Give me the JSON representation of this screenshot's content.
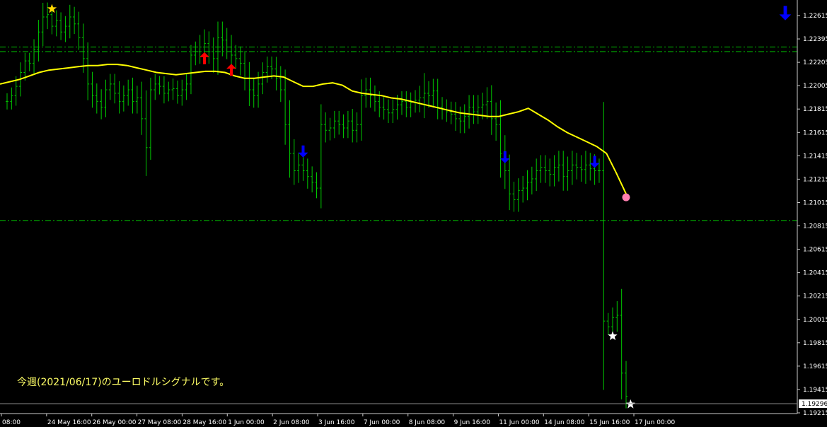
{
  "caption": "今週(2021/06/17)のユーロドルシグナルです。",
  "colors": {
    "background": "#000000",
    "bars": "#00c800",
    "ma_line": "#ffff00",
    "levels": "#00c800",
    "axis": "#cccccc",
    "up_arrow": "#ff0000",
    "down_arrow": "#0000ff",
    "gold_star": "#ffd700",
    "white_star": "#ffffff",
    "pink_dot": "#ff7fb0",
    "current_price_box": "#ffffff"
  },
  "chart_data": {
    "type": "ohlc-line",
    "instrument": "EURUSD",
    "ylim": [
      1.1915,
      1.2269
    ],
    "y_ticks": [
      "1.22615",
      "1.22395",
      "1.22205",
      "1.22005",
      "1.21815",
      "1.21615",
      "1.21415",
      "1.21215",
      "1.21015",
      "1.20815",
      "1.20615",
      "1.20415",
      "1.20215",
      "1.20015",
      "1.19815",
      "1.19615",
      "1.19415",
      "1.19215"
    ],
    "current_price": "1.19296",
    "x_ticks": [
      "08:00",
      "24 May 16:00",
      "26 May 00:00",
      "27 May 08:00",
      "28 May 16:00",
      "1 Jun 00:00",
      "2 Jun 08:00",
      "3 Jun 16:00",
      "7 Jun 00:00",
      "8 Jun 08:00",
      "9 Jun 16:00",
      "11 Jun 00:00",
      "14 Jun 08:00",
      "15 Jun 16:00",
      "17 Jun 00:00"
    ],
    "horizontal_levels": [
      1.2232,
      1.2228,
      1.2082
    ],
    "bars_close": [
      1.2185,
      1.219,
      1.2198,
      1.221,
      1.222,
      1.2218,
      1.223,
      1.2245,
      1.2258,
      1.226,
      1.225,
      1.2255,
      1.2245,
      1.225,
      1.2258,
      1.2252,
      1.224,
      1.2222,
      1.22,
      1.219,
      1.2185,
      1.218,
      1.2195,
      1.22,
      1.2192,
      1.2185,
      1.219,
      1.2195,
      1.2185,
      1.2188,
      1.217,
      1.2145,
      1.2195,
      1.22,
      1.2198,
      1.2192,
      1.2195,
      1.2196,
      1.219,
      1.2195,
      1.22,
      1.2225,
      1.2228,
      1.2232,
      1.2235,
      1.2228,
      1.2222,
      1.224,
      1.2238,
      1.2232,
      1.2225,
      1.2222,
      1.2218,
      1.2205,
      1.2195,
      1.219,
      1.22,
      1.221,
      1.2215,
      1.2213,
      1.2205,
      1.2195,
      1.2165,
      1.214,
      1.2125,
      1.213,
      1.2125,
      1.212,
      1.2115,
      1.211,
      1.2165,
      1.216,
      1.2162,
      1.2168,
      1.2165,
      1.2162,
      1.2168,
      1.216,
      1.2165,
      1.219,
      1.2195,
      1.219,
      1.2185,
      1.218,
      1.2178,
      1.2175,
      1.2178,
      1.2182,
      1.2185,
      1.218,
      1.2184,
      1.2186,
      1.2188,
      1.2192,
      1.219,
      1.2194,
      1.218,
      1.2178,
      1.2176,
      1.2174,
      1.217,
      1.2168,
      1.2172,
      1.218,
      1.2176,
      1.218,
      1.2182,
      1.2185,
      1.217,
      1.2165,
      1.214,
      1.2125,
      1.2105,
      1.21,
      1.2108,
      1.211,
      1.2115,
      1.2118,
      1.2125,
      1.2128,
      1.2125,
      1.2122,
      1.2128,
      1.213,
      1.212,
      1.2125,
      1.213,
      1.2128,
      1.2126,
      1.213,
      1.2127,
      1.2125,
      1.2125,
      1.1995,
      1.199,
      1.1998,
      1.2,
      1.195,
      1.193
    ],
    "bars_range": [
      0.002,
      0.002,
      0.0025,
      0.0025,
      0.002,
      0.002,
      0.0025,
      0.003,
      0.0035,
      0.003,
      0.002,
      0.0025,
      0.002,
      0.0025,
      0.003,
      0.0025,
      0.003,
      0.0035,
      0.004,
      0.003,
      0.003,
      0.003,
      0.0025,
      0.0025,
      0.0025,
      0.003,
      0.0025,
      0.0025,
      0.003,
      0.003,
      0.004,
      0.007,
      0.003,
      0.0025,
      0.002,
      0.0025,
      0.002,
      0.0025,
      0.002,
      0.0025,
      0.0025,
      0.0025,
      0.0025,
      0.003,
      0.0035,
      0.003,
      0.0035,
      0.004,
      0.004,
      0.003,
      0.003,
      0.0025,
      0.003,
      0.003,
      0.004,
      0.003,
      0.003,
      0.0025,
      0.0025,
      0.0025,
      0.003,
      0.003,
      0.005,
      0.006,
      0.0035,
      0.003,
      0.0025,
      0.003,
      0.0025,
      0.0025,
      0.005,
      0.003,
      0.0025,
      0.0025,
      0.0025,
      0.0025,
      0.0025,
      0.003,
      0.003,
      0.004,
      0.003,
      0.003,
      0.0025,
      0.0025,
      0.0025,
      0.0025,
      0.0025,
      0.0025,
      0.0025,
      0.0025,
      0.0025,
      0.0025,
      0.003,
      0.005,
      0.003,
      0.003,
      0.003,
      0.0025,
      0.0025,
      0.0025,
      0.003,
      0.003,
      0.003,
      0.003,
      0.003,
      0.003,
      0.003,
      0.0035,
      0.004,
      0.004,
      0.006,
      0.0045,
      0.004,
      0.003,
      0.003,
      0.003,
      0.003,
      0.003,
      0.003,
      0.003,
      0.003,
      0.003,
      0.003,
      0.0035,
      0.0035,
      0.0035,
      0.0035,
      0.003,
      0.003,
      0.0035,
      0.003,
      0.0035,
      0.003,
      0.017,
      0.002,
      0.0025,
      0.0035,
      0.0065,
      0.003
    ],
    "ma_line": [
      1.22,
      1.2202,
      1.2204,
      1.2207,
      1.221,
      1.2212,
      1.2213,
      1.2214,
      1.2215,
      1.2216,
      1.2216,
      1.2217,
      1.2217,
      1.2216,
      1.2214,
      1.2212,
      1.221,
      1.2209,
      1.2208,
      1.2209,
      1.221,
      1.2211,
      1.2211,
      1.221,
      1.2207,
      1.2205,
      1.2205,
      1.2206,
      1.2207,
      1.2206,
      1.2202,
      1.2198,
      1.2198,
      1.22,
      1.2201,
      1.2199,
      1.2194,
      1.2192,
      1.2191,
      1.219,
      1.2188,
      1.2187,
      1.2185,
      1.2183,
      1.2181,
      1.2179,
      1.2177,
      1.2175,
      1.2174,
      1.2173,
      1.2172,
      1.2172,
      1.2174,
      1.2176,
      1.2179,
      1.2174,
      1.2169,
      1.2163,
      1.2158,
      1.2154,
      1.215,
      1.2146,
      1.214,
      1.2123,
      1.2105
    ],
    "signals_up": [
      [
        44,
        1.2222
      ],
      [
        50,
        1.2212
      ]
    ],
    "signals_down": [
      [
        66,
        1.2142
      ],
      [
        111,
        1.2137
      ],
      [
        131,
        1.2133
      ]
    ],
    "signal_down_corner": true,
    "gold_star": [
      10,
      1.2265
    ],
    "white_stars": [
      [
        135,
        1.1982
      ],
      [
        139,
        1.1923
      ]
    ],
    "end_dot": [
      1.2102
    ]
  }
}
